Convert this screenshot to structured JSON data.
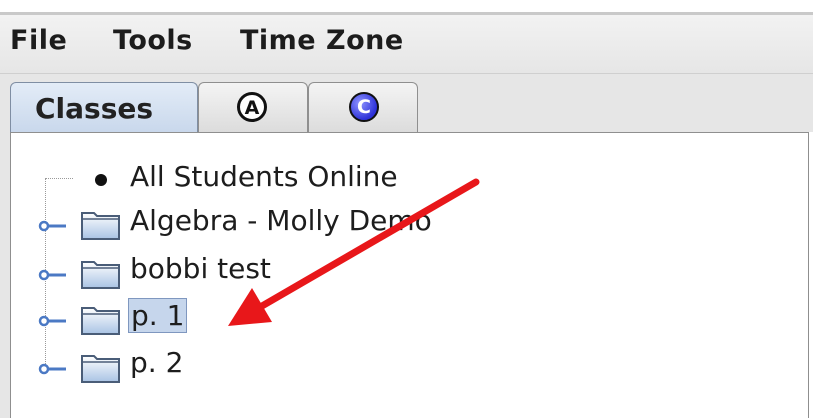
{
  "menu": {
    "items": [
      {
        "label": "File"
      },
      {
        "label": "Tools"
      },
      {
        "label": "Time Zone"
      }
    ]
  },
  "tabs": [
    {
      "label": "Classes",
      "active": true
    },
    {
      "label": "A",
      "icon": "a-circle-icon"
    },
    {
      "label": "C",
      "icon": "c-circle-icon"
    }
  ],
  "tree": {
    "root": {
      "label": "All Students Online"
    },
    "items": [
      {
        "label": "Algebra - Molly Demo",
        "selected": false
      },
      {
        "label": "bobbi test",
        "selected": false
      },
      {
        "label": "p. 1",
        "selected": true
      },
      {
        "label": "p. 2",
        "selected": false
      }
    ]
  },
  "annotation": {
    "arrow_color": "#e8171a",
    "arrow_target": "p. 1"
  }
}
